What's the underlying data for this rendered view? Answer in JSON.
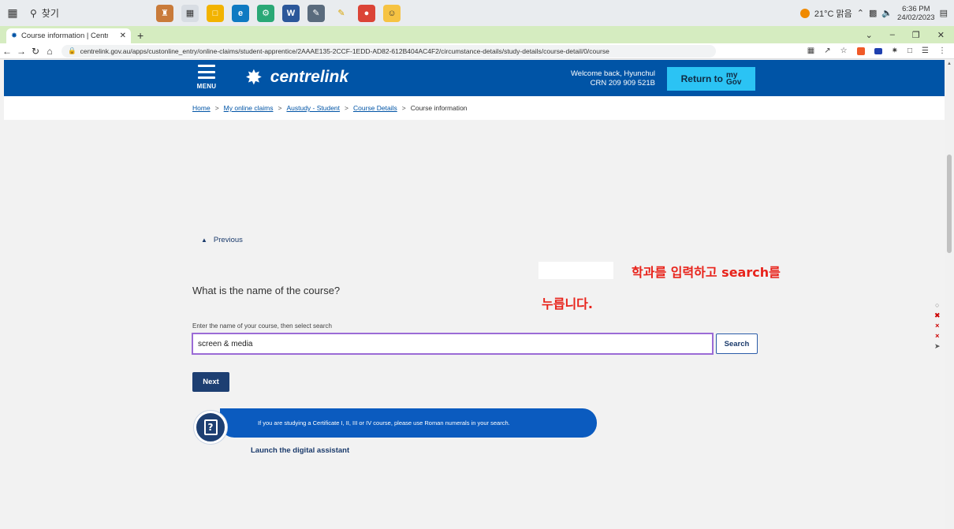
{
  "taskbar": {
    "search_label": "찾기",
    "weather": "21°C 맑음",
    "time": "6:36 PM",
    "date": "24/02/2023"
  },
  "browser": {
    "tab_title": "Course information | Centrelink",
    "url": "centrelink.gov.au/apps/custonline_entry/online-claims/student-apprentice/2AAAE135-2CCF-1EDD-AD82-612B404AC4F2/circumstance-details/study-details/course-detail/0/course"
  },
  "header": {
    "menu_label": "MENU",
    "logo_text": "centrelink",
    "welcome_line1": "Welcome back, Hyunchul",
    "welcome_line2": "CRN 209 909 521B",
    "return_label": "Return to",
    "mygov_top": "my",
    "mygov_bottom": "Gov"
  },
  "breadcrumb": {
    "items": [
      "Home",
      "My online claims",
      "Austudy - Student",
      "Course Details"
    ],
    "current": "Course information",
    "separator": ">"
  },
  "form": {
    "previous_label": "Previous",
    "question": "What is the name of the course?",
    "field_label": "Enter the name of your course, then select search",
    "course_value": "screen & media",
    "search_label": "Search",
    "next_label": "Next"
  },
  "annotation": {
    "line1": "학과를 입력하고 search를",
    "line2": "누릅니다.",
    "color": "#e8231b"
  },
  "assistant": {
    "message": "If you are studying a Certificate I, II, III or IV course, please use Roman numerals in your search.",
    "link_label": "Launch the digital assistant"
  },
  "colors": {
    "brand_blue": "#0054a6",
    "mygov_cyan": "#2bc3f4",
    "navy": "#1d3f72",
    "input_focus": "#9b6bd6"
  }
}
